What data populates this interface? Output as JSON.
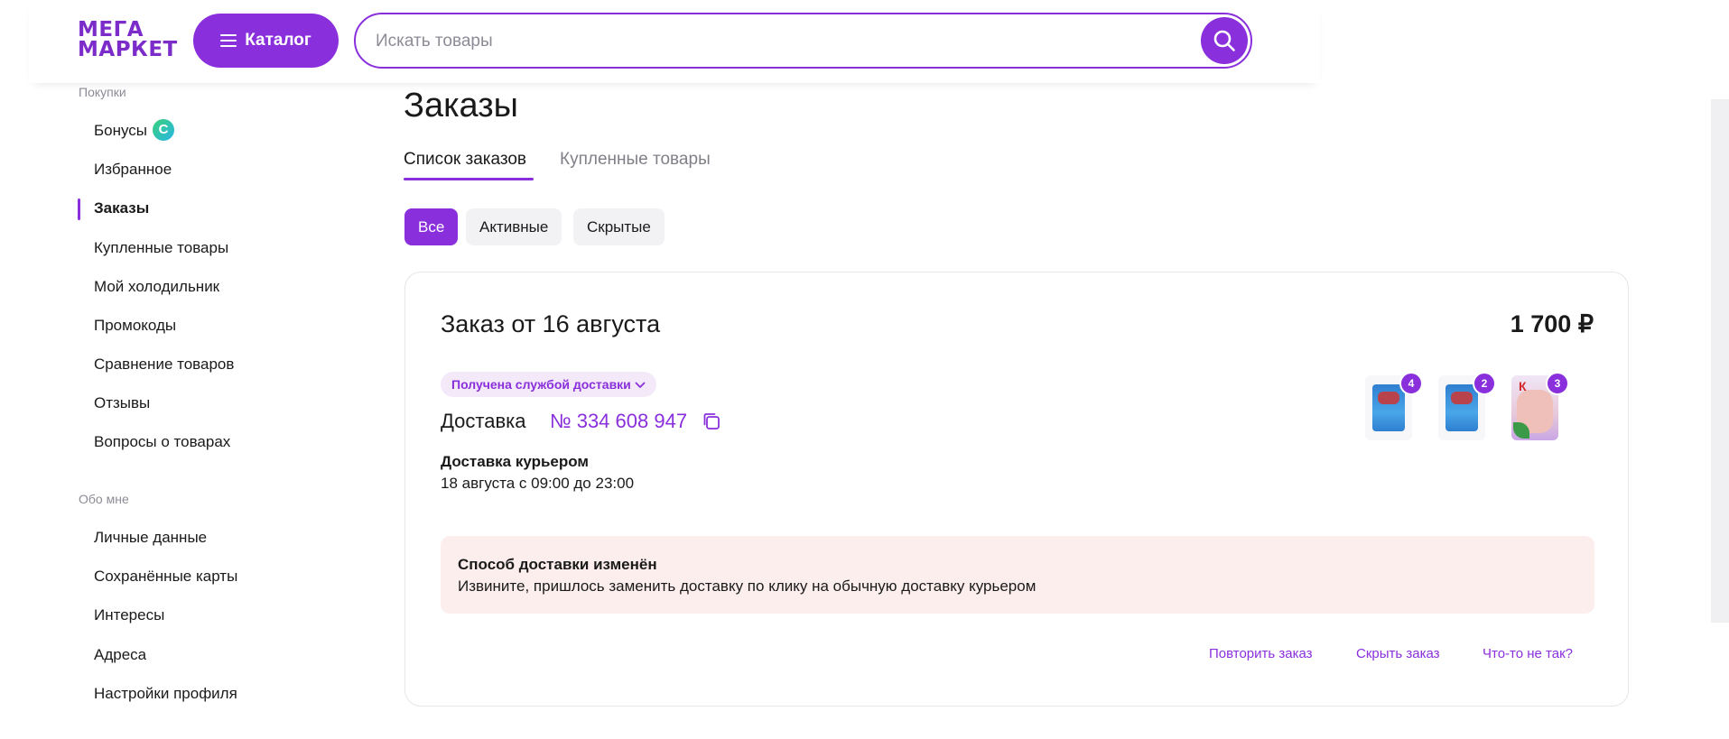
{
  "header": {
    "logo_line1": "МЕГА",
    "logo_line2": "МАРКЕТ",
    "catalog_label": "Каталог",
    "search_placeholder": "Искать товары",
    "search_value": ""
  },
  "sidebar": {
    "sections": [
      {
        "title": "Покупки",
        "items": [
          {
            "label": "Бонусы",
            "badge": "С"
          },
          {
            "label": "Избранное"
          },
          {
            "label": "Заказы",
            "active": true
          },
          {
            "label": "Купленные товары"
          },
          {
            "label": "Мой холодильник"
          },
          {
            "label": "Промокоды"
          },
          {
            "label": "Сравнение товаров"
          },
          {
            "label": "Отзывы"
          },
          {
            "label": "Вопросы о товарах"
          }
        ]
      },
      {
        "title": "Обо мне",
        "items": [
          {
            "label": "Личные данные"
          },
          {
            "label": "Сохранённые карты"
          },
          {
            "label": "Интересы"
          },
          {
            "label": "Адреса"
          },
          {
            "label": "Настройки профиля"
          }
        ]
      }
    ]
  },
  "main": {
    "title": "Заказы",
    "tabs": [
      {
        "label": "Список заказов",
        "active": true
      },
      {
        "label": "Купленные товары",
        "active": false
      }
    ],
    "filters": [
      {
        "label": "Все",
        "selected": true
      },
      {
        "label": "Активные",
        "selected": false
      },
      {
        "label": "Скрытые",
        "selected": false
      }
    ],
    "order": {
      "title": "Заказ от 16 августа",
      "total": "1 700 ₽",
      "status": "Получена службой доставки",
      "delivery_label": "Доставка",
      "delivery_number": "№ 334 608 947",
      "delivery_method": "Доставка курьером",
      "delivery_time": "18 августа с 09:00 до 23:00",
      "items": [
        {
          "icon": "meat-pack-product-image",
          "qty": "4"
        },
        {
          "icon": "meat-pack-product-image",
          "qty": "2"
        },
        {
          "icon": "chicken-product-image",
          "qty": "3",
          "brand_mark": "К"
        }
      ],
      "notice": {
        "title": "Способ доставки изменён",
        "text": "Извините, пришлось заменить доставку по клику на обычную доставку курьером"
      },
      "actions": [
        "Повторить заказ",
        "Скрыть заказ",
        "Что-то не так?"
      ]
    }
  },
  "colors": {
    "accent": "#8a2fdc",
    "logo": "#7b2cc9",
    "notice_bg": "#fdeeee",
    "status_bg": "#f3e9f9"
  }
}
